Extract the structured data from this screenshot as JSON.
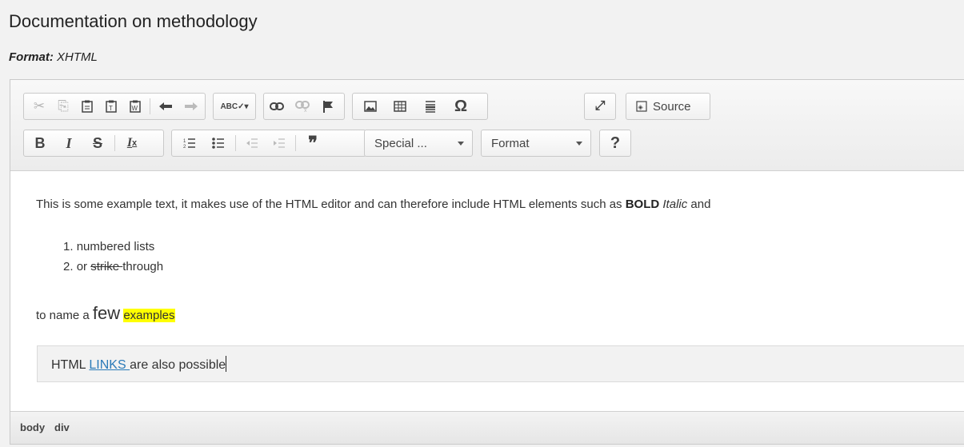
{
  "page": {
    "title": "Documentation on methodology",
    "format_label": "Format:",
    "format_value": "XHTML"
  },
  "toolbar": {
    "row1": [
      {
        "name": "cut-icon",
        "glyph": "✂",
        "disabled": true
      },
      {
        "name": "copy-icon",
        "glyph": "⎘",
        "disabled": true
      },
      {
        "name": "paste-icon",
        "glyph": "📋",
        "disabled": false
      },
      {
        "name": "paste-text-icon",
        "glyph": "📋",
        "disabled": false
      },
      {
        "name": "paste-word-icon",
        "glyph": "📋",
        "disabled": false
      },
      {
        "name": "undo-icon",
        "glyph": "↶",
        "disabled": false
      },
      {
        "name": "redo-icon",
        "glyph": "↷",
        "disabled": true
      },
      {
        "name": "spellcheck-icon",
        "glyph": "ABC✓",
        "disabled": false
      },
      {
        "name": "link-icon",
        "glyph": "⛓",
        "disabled": false
      },
      {
        "name": "unlink-icon",
        "glyph": "⛓",
        "disabled": true
      },
      {
        "name": "anchor-icon",
        "glyph": "⚑",
        "disabled": false
      },
      {
        "name": "image-icon",
        "glyph": "▣",
        "disabled": false
      },
      {
        "name": "table-icon",
        "glyph": "⊞",
        "disabled": false
      },
      {
        "name": "horizontal-line-icon",
        "glyph": "≡",
        "disabled": false
      },
      {
        "name": "special-char-icon",
        "glyph": "Ω",
        "disabled": false
      },
      {
        "name": "maximize-icon",
        "glyph": "⤢",
        "disabled": false
      }
    ],
    "source_label": "Source",
    "row2": [
      {
        "name": "bold-icon",
        "glyph": "B"
      },
      {
        "name": "italic-icon",
        "glyph": "I"
      },
      {
        "name": "strike-icon",
        "glyph": "S"
      },
      {
        "name": "remove-format-icon",
        "glyph": "Tx"
      },
      {
        "name": "numbered-list-icon",
        "glyph": "⒈"
      },
      {
        "name": "bulleted-list-icon",
        "glyph": "•"
      },
      {
        "name": "outdent-icon",
        "glyph": "⇤"
      },
      {
        "name": "indent-icon",
        "glyph": "⇥"
      },
      {
        "name": "blockquote-icon",
        "glyph": "❞"
      }
    ],
    "special_label": "Special ...",
    "format_label": "Format",
    "help_label": "?"
  },
  "content": {
    "para1_start": "This is some example text, it makes use of the HTML editor and can therefore include HTML elements such as ",
    "para1_bold": "BOLD",
    "para1_italic": "Italic",
    "para1_end": " and",
    "list_item1": "numbered lists",
    "list_item2_pre": "or ",
    "list_item2_strike": "strike ",
    "list_item2_post": "through",
    "para2_pre": "to name a ",
    "para2_big": "few",
    "para2_highlight": "examples",
    "note_pre": "HTML ",
    "note_link": "LINKS ",
    "note_post": "are also possible"
  },
  "statusbar": {
    "crumb1": "body",
    "crumb2": "div"
  },
  "colors": {
    "highlight": "#ffff00",
    "link": "#2a7ab8"
  }
}
